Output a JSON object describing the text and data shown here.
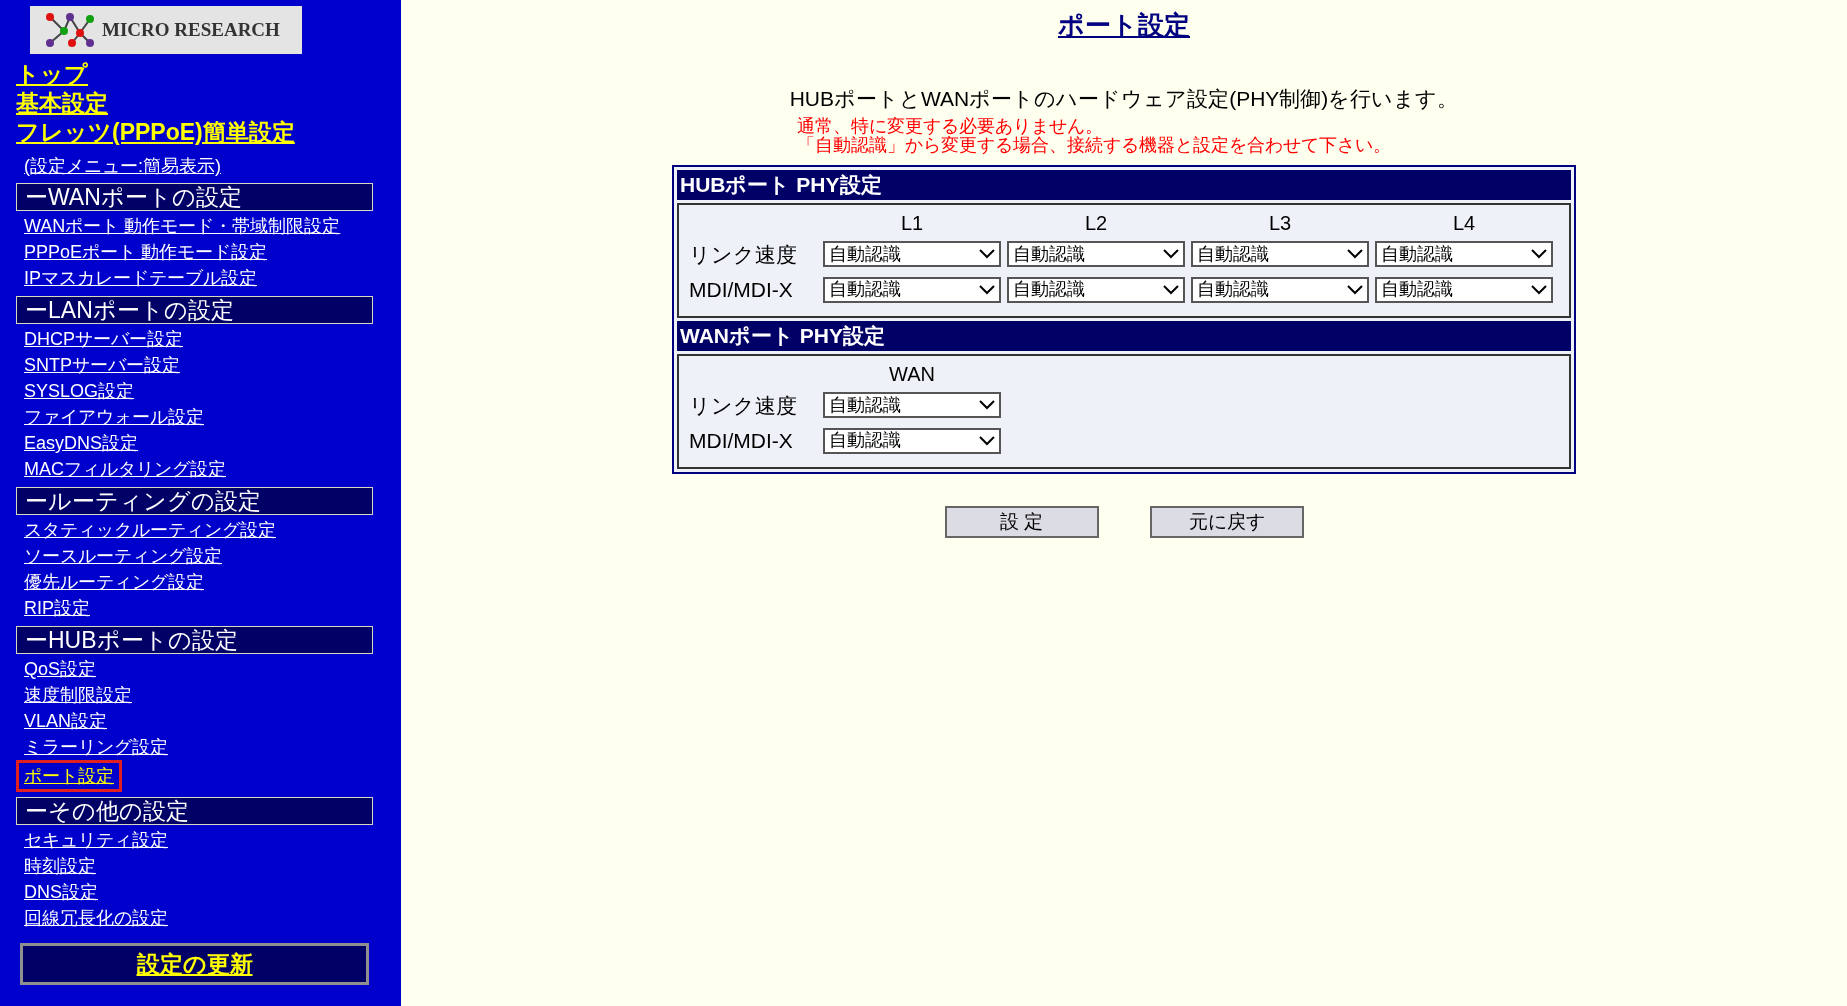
{
  "sidebar": {
    "logo": "MICRO RESEARCH",
    "top_links": [
      "トップ",
      "基本設定",
      "フレッツ(PPPoE)簡単設定"
    ],
    "menu_mode_link": "(設定メニュー:簡易表示)",
    "sections": [
      {
        "title": "ーWANポートの設定",
        "items": [
          {
            "label": "WANポート 動作モード・帯域制限設定",
            "selected": false
          },
          {
            "label": "PPPoEポート 動作モード設定",
            "selected": false
          },
          {
            "label": "IPマスカレードテーブル設定",
            "selected": false
          }
        ]
      },
      {
        "title": "ーLANポートの設定",
        "items": [
          {
            "label": "DHCPサーバー設定",
            "selected": false
          },
          {
            "label": "SNTPサーバー設定",
            "selected": false
          },
          {
            "label": "SYSLOG設定",
            "selected": false
          },
          {
            "label": "ファイアウォール設定",
            "selected": false
          },
          {
            "label": "EasyDNS設定",
            "selected": false
          },
          {
            "label": "MACフィルタリング設定",
            "selected": false
          }
        ]
      },
      {
        "title": "ールーティングの設定",
        "items": [
          {
            "label": "スタティックルーティング設定",
            "selected": false
          },
          {
            "label": "ソースルーティング設定",
            "selected": false
          },
          {
            "label": "優先ルーティング設定",
            "selected": false
          },
          {
            "label": "RIP設定",
            "selected": false
          }
        ]
      },
      {
        "title": "ーHUBポートの設定",
        "items": [
          {
            "label": "QoS設定",
            "selected": false
          },
          {
            "label": "速度制限設定",
            "selected": false
          },
          {
            "label": "VLAN設定",
            "selected": false
          },
          {
            "label": "ミラーリング設定",
            "selected": false
          },
          {
            "label": "ポート設定",
            "selected": true
          }
        ]
      },
      {
        "title": "ーその他の設定",
        "items": [
          {
            "label": "セキュリティ設定",
            "selected": false
          },
          {
            "label": "時刻設定",
            "selected": false
          },
          {
            "label": "DNS設定",
            "selected": false
          },
          {
            "label": "回線冗長化の設定",
            "selected": false
          }
        ]
      }
    ],
    "update_button": "設定の更新"
  },
  "main": {
    "title": "ポート設定",
    "description": "HUBポートとWANポートのハードウェア設定(PHY制御)を行います。",
    "notes": [
      "通常、特に変更する必要ありません。",
      "「自動認識」から変更する場合、接続する機器と設定を合わせて下さい。"
    ],
    "panels": [
      {
        "title": "HUBポート PHY設定",
        "columns": [
          "L1",
          "L2",
          "L3",
          "L4"
        ],
        "rows": [
          {
            "label": "リンク速度",
            "values": [
              "自動認識",
              "自動認識",
              "自動認識",
              "自動認識"
            ]
          },
          {
            "label": "MDI/MDI-X",
            "values": [
              "自動認識",
              "自動認識",
              "自動認識",
              "自動認識"
            ]
          }
        ]
      },
      {
        "title": "WANポート PHY設定",
        "columns": [
          "WAN"
        ],
        "rows": [
          {
            "label": "リンク速度",
            "values": [
              "自動認識"
            ]
          },
          {
            "label": "MDI/MDI-X",
            "values": [
              "自動認識"
            ]
          }
        ]
      }
    ],
    "buttons": [
      "設 定",
      "元に戻す"
    ]
  }
}
